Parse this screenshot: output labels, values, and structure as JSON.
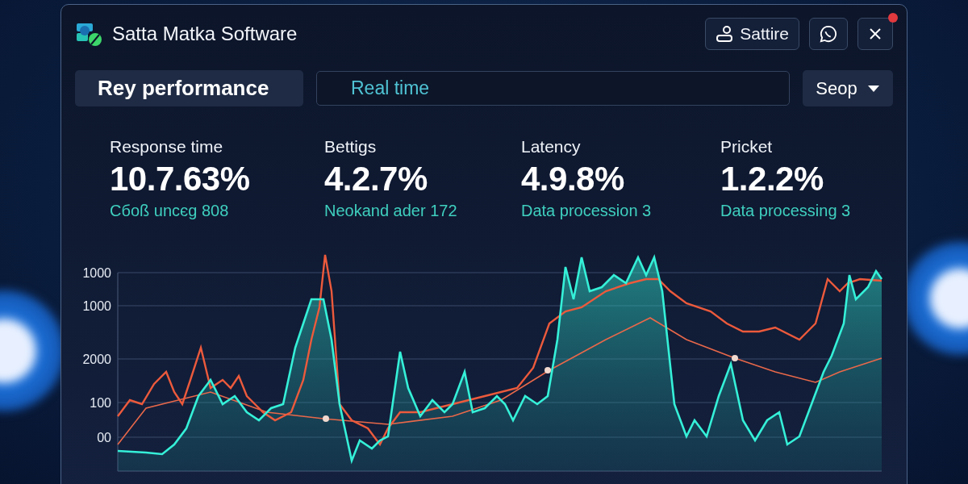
{
  "window": {
    "title": "Satta Matka Software"
  },
  "header_actions": {
    "account_button": {
      "label": "Sattire"
    },
    "close_badge": true
  },
  "toolbar": {
    "view_button": {
      "label": "Rey performance"
    },
    "range_field": {
      "value": "Real time"
    },
    "dropdown": {
      "label": "Seop"
    }
  },
  "stats": [
    {
      "label": "Response time",
      "value": "10.7.63%",
      "detail": "Cбoß uncєg 808"
    },
    {
      "label": "Bettigs",
      "value": "4.2.7%",
      "detail": "Neokand ader 172"
    },
    {
      "label": "Latency",
      "value": "4.9.8%",
      "detail": "Data procession 3"
    },
    {
      "label": "Pricket",
      "value": "1.2.2%",
      "detail": "Data processing 3"
    }
  ],
  "chart": {
    "y_axis_labels": [
      "1000",
      "1000",
      "2000",
      "100",
      "00"
    ]
  }
}
